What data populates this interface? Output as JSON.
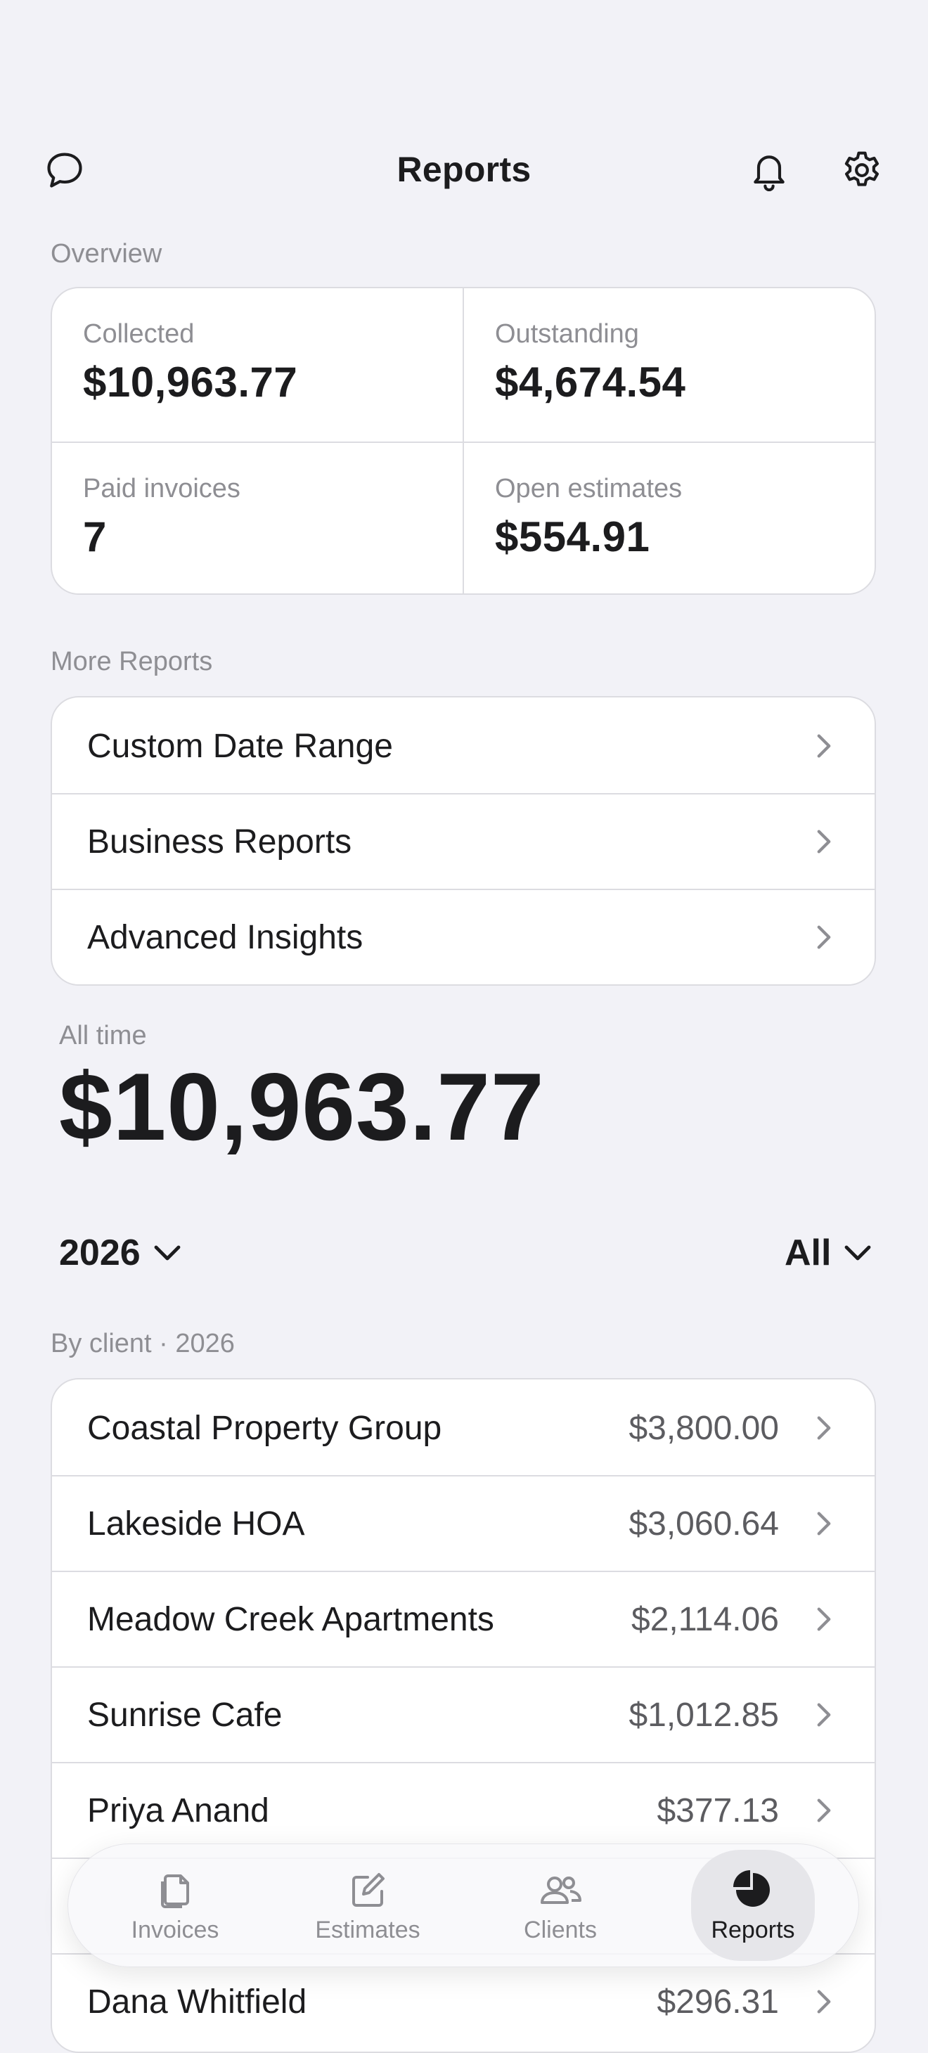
{
  "header": {
    "title": "Reports",
    "left_icon": "chat-bubble-icon",
    "right_icons": [
      "bell-icon",
      "gear-icon"
    ]
  },
  "overview": {
    "section_label": "Overview",
    "stats": [
      {
        "label": "Collected",
        "value": "$10,963.77"
      },
      {
        "label": "Outstanding",
        "value": "$4,674.54"
      },
      {
        "label": "Paid invoices",
        "value": "7"
      },
      {
        "label": "Open estimates",
        "value": "$554.91"
      }
    ]
  },
  "more_reports": {
    "section_label": "More Reports",
    "items": [
      {
        "label": "Custom Date Range"
      },
      {
        "label": "Business Reports"
      },
      {
        "label": "Advanced Insights"
      }
    ]
  },
  "all_time": {
    "label": "All time",
    "value": "$10,963.77"
  },
  "filters": {
    "year": "2026",
    "scope": "All"
  },
  "by_client": {
    "section_label": "By client · 2026",
    "clients": [
      {
        "name": "Coastal Property Group",
        "amount": "$3,800.00"
      },
      {
        "name": "Lakeside HOA",
        "amount": "$3,060.64"
      },
      {
        "name": "Meadow Creek Apartments",
        "amount": "$2,114.06"
      },
      {
        "name": "Sunrise Cafe",
        "amount": "$1,012.85"
      },
      {
        "name": "Priya Anand",
        "amount": "$377.13"
      },
      {
        "name": "Dana Whitfield",
        "amount": "$296.31"
      }
    ]
  },
  "tabbar": {
    "tabs": [
      {
        "label": "Invoices",
        "icon": "invoices-icon"
      },
      {
        "label": "Estimates",
        "icon": "estimates-icon"
      },
      {
        "label": "Clients",
        "icon": "clients-icon"
      },
      {
        "label": "Reports",
        "icon": "reports-pie-icon",
        "active": true
      }
    ]
  }
}
